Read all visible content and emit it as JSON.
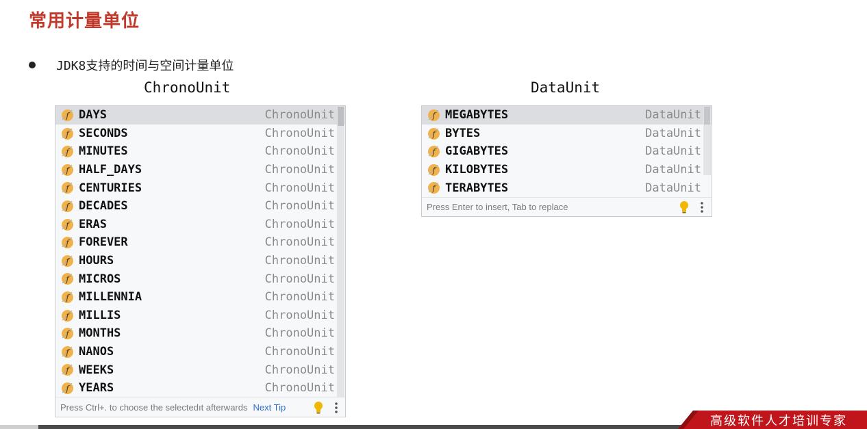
{
  "slide": {
    "title": "常用计量单位",
    "bullet": "JDK8支持的时间与空间计量单位"
  },
  "chrono": {
    "heading": "ChronoUnit",
    "items": [
      {
        "name": "DAYS",
        "type": "ChronoUnit"
      },
      {
        "name": "SECONDS",
        "type": "ChronoUnit"
      },
      {
        "name": "MINUTES",
        "type": "ChronoUnit"
      },
      {
        "name": "HALF_DAYS",
        "type": "ChronoUnit"
      },
      {
        "name": "CENTURIES",
        "type": "ChronoUnit"
      },
      {
        "name": "DECADES",
        "type": "ChronoUnit"
      },
      {
        "name": "ERAS",
        "type": "ChronoUnit"
      },
      {
        "name": "FOREVER",
        "type": "ChronoUnit"
      },
      {
        "name": "HOURS",
        "type": "ChronoUnit"
      },
      {
        "name": "MICROS",
        "type": "ChronoUnit"
      },
      {
        "name": "MILLENNIA",
        "type": "ChronoUnit"
      },
      {
        "name": "MILLIS",
        "type": "ChronoUnit"
      },
      {
        "name": "MONTHS",
        "type": "ChronoUnit"
      },
      {
        "name": "NANOS",
        "type": "ChronoUnit"
      },
      {
        "name": "WEEKS",
        "type": "ChronoUnit"
      },
      {
        "name": "YEARS",
        "type": "ChronoUnit"
      }
    ],
    "footer_hint": "Press Ctrl+. to choose the selectedıt afterwards",
    "next_tip": "Next Tip"
  },
  "data_unit": {
    "heading": "DataUnit",
    "items": [
      {
        "name": "MEGABYTES",
        "type": "DataUnit"
      },
      {
        "name": "BYTES",
        "type": "DataUnit"
      },
      {
        "name": "GIGABYTES",
        "type": "DataUnit"
      },
      {
        "name": "KILOBYTES",
        "type": "DataUnit"
      },
      {
        "name": "TERABYTES",
        "type": "DataUnit"
      }
    ],
    "footer_hint": "Press Enter to insert, Tab to replace"
  },
  "branding": {
    "tagline": "高级软件人才培训专家"
  },
  "icons": {
    "field": "field-f-icon",
    "bulb": "lightbulb-icon",
    "menu": "more-vertical-icon"
  },
  "colors": {
    "title_red": "#c0392b",
    "brand_red": "#c0161b",
    "field_icon": "#f2b24b",
    "bulb": "#f2b705",
    "link_blue": "#2f6fc9"
  }
}
